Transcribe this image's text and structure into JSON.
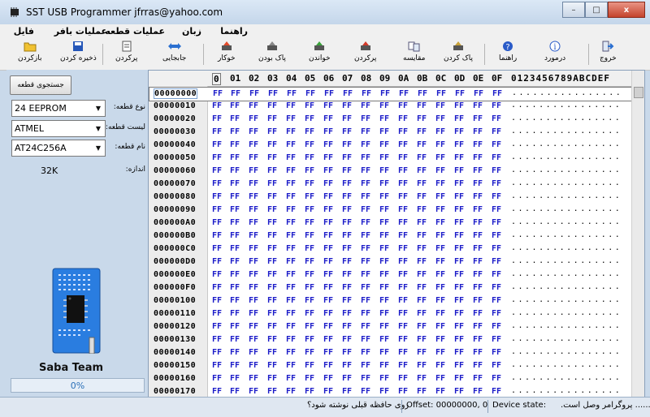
{
  "window": {
    "title": "SST USB Programmer   jfrras@yahoo.com",
    "close_label": "x",
    "minimize_label": "–",
    "maximize_label": "□"
  },
  "menu": [
    "فایل",
    "عملیات بافر",
    "عملیات قطعه",
    "زبان",
    "راهنما"
  ],
  "toolbar": [
    {
      "label": "بازکردن",
      "icon": "folder-open-icon"
    },
    {
      "label": "ذخیره کردن",
      "icon": "save-icon"
    },
    {
      "label": "پرکردن",
      "icon": "fill-icon"
    },
    {
      "label": "جابجایی",
      "icon": "swap-icon"
    },
    {
      "label": "خوکار",
      "icon": "auto-icon"
    },
    {
      "label": "پاک بودن",
      "icon": "blank-check-icon"
    },
    {
      "label": "خواندن",
      "icon": "read-icon"
    },
    {
      "label": "پرکردن",
      "icon": "program-icon"
    },
    {
      "label": "مقایسه",
      "icon": "compare-icon"
    },
    {
      "label": "پاک کردن",
      "icon": "erase-icon"
    },
    {
      "label": "راهنما",
      "icon": "help-icon"
    },
    {
      "label": "درمورد",
      "icon": "info-icon"
    },
    {
      "label": "خروج",
      "icon": "exit-icon"
    }
  ],
  "left": {
    "search_button": "جستجوی قطعه",
    "type_label": "نوع قطعه:",
    "type_value": "24 EEPROM",
    "list_label": "لیست قطعه:",
    "list_value": "ATMEL",
    "name_label": "نام قطعه:",
    "name_value": "AT24C256A",
    "size_label": "اندازه:",
    "size_value": "32K",
    "team": "Saba Team",
    "progress": "0%",
    "progress_fraction": 0
  },
  "hex": {
    "header_corner": "0",
    "columns": [
      "0",
      "01",
      "02",
      "03",
      "04",
      "05",
      "06",
      "07",
      "08",
      "09",
      "0A",
      "0B",
      "0C",
      "0D",
      "0E",
      "0F"
    ],
    "ascii_header": "0123456789ABCDEF",
    "byte_value": "FF",
    "ascii_value": "................",
    "selected_row": "00000000",
    "rows": [
      "00000000",
      "00000010",
      "00000020",
      "00000030",
      "00000040",
      "00000050",
      "00000060",
      "00000070",
      "00000080",
      "00000090",
      "000000A0",
      "000000B0",
      "000000C0",
      "000000D0",
      "000000E0",
      "000000F0",
      "00000100",
      "00000110",
      "00000120",
      "00000130",
      "00000140",
      "00000150",
      "00000160",
      "00000170"
    ]
  },
  "status": {
    "warning": "روی حافظه قبلی نوشته شود؟",
    "offset": "Offset: 00000000, 0",
    "device_state": "Device state:",
    "connected": "...... پروگرامر وصل است."
  },
  "colors": {
    "accent": "#1a1ac8",
    "window_bg": "#c9d9ea",
    "chip_board": "#2a7de0",
    "close_button": "#c4442d"
  }
}
